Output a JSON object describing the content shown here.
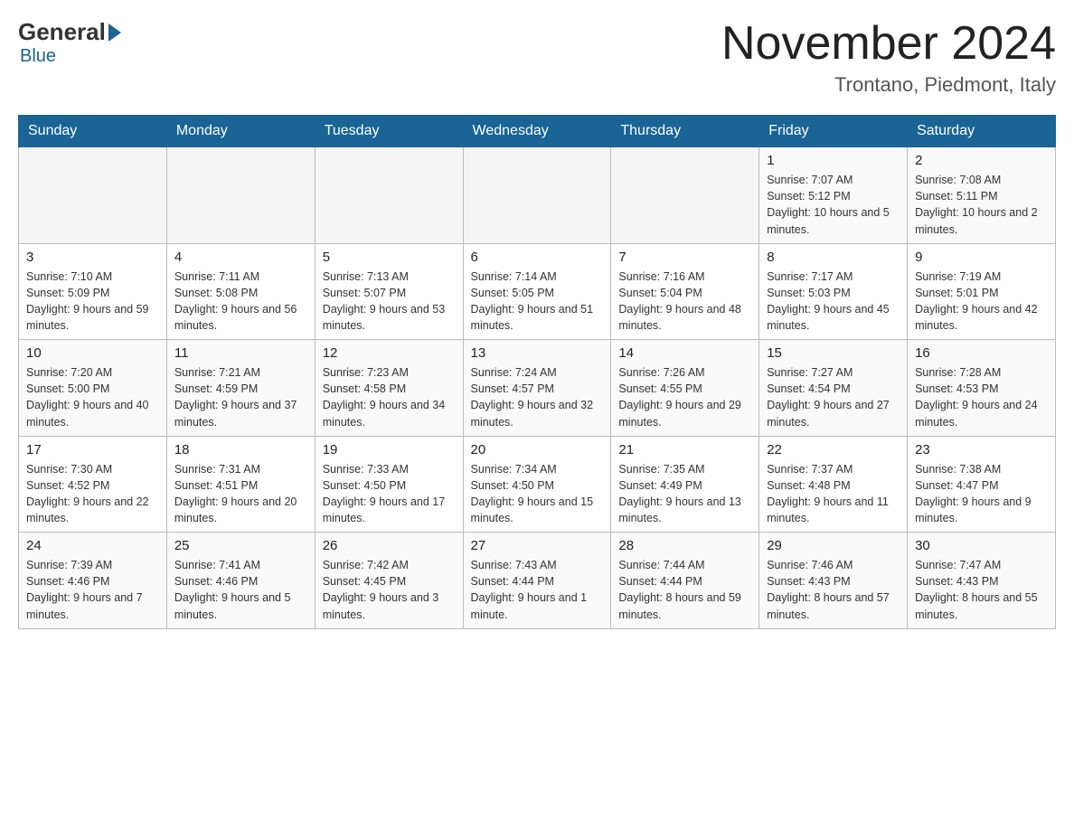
{
  "header": {
    "logo_general": "General",
    "logo_blue": "Blue",
    "month_title": "November 2024",
    "location": "Trontano, Piedmont, Italy"
  },
  "days_of_week": [
    "Sunday",
    "Monday",
    "Tuesday",
    "Wednesday",
    "Thursday",
    "Friday",
    "Saturday"
  ],
  "weeks": [
    {
      "row_style": "odd",
      "days": [
        {
          "date": "",
          "info": ""
        },
        {
          "date": "",
          "info": ""
        },
        {
          "date": "",
          "info": ""
        },
        {
          "date": "",
          "info": ""
        },
        {
          "date": "",
          "info": ""
        },
        {
          "date": "1",
          "info": "Sunrise: 7:07 AM\nSunset: 5:12 PM\nDaylight: 10 hours and 5 minutes."
        },
        {
          "date": "2",
          "info": "Sunrise: 7:08 AM\nSunset: 5:11 PM\nDaylight: 10 hours and 2 minutes."
        }
      ]
    },
    {
      "row_style": "even",
      "days": [
        {
          "date": "3",
          "info": "Sunrise: 7:10 AM\nSunset: 5:09 PM\nDaylight: 9 hours and 59 minutes."
        },
        {
          "date": "4",
          "info": "Sunrise: 7:11 AM\nSunset: 5:08 PM\nDaylight: 9 hours and 56 minutes."
        },
        {
          "date": "5",
          "info": "Sunrise: 7:13 AM\nSunset: 5:07 PM\nDaylight: 9 hours and 53 minutes."
        },
        {
          "date": "6",
          "info": "Sunrise: 7:14 AM\nSunset: 5:05 PM\nDaylight: 9 hours and 51 minutes."
        },
        {
          "date": "7",
          "info": "Sunrise: 7:16 AM\nSunset: 5:04 PM\nDaylight: 9 hours and 48 minutes."
        },
        {
          "date": "8",
          "info": "Sunrise: 7:17 AM\nSunset: 5:03 PM\nDaylight: 9 hours and 45 minutes."
        },
        {
          "date": "9",
          "info": "Sunrise: 7:19 AM\nSunset: 5:01 PM\nDaylight: 9 hours and 42 minutes."
        }
      ]
    },
    {
      "row_style": "odd",
      "days": [
        {
          "date": "10",
          "info": "Sunrise: 7:20 AM\nSunset: 5:00 PM\nDaylight: 9 hours and 40 minutes."
        },
        {
          "date": "11",
          "info": "Sunrise: 7:21 AM\nSunset: 4:59 PM\nDaylight: 9 hours and 37 minutes."
        },
        {
          "date": "12",
          "info": "Sunrise: 7:23 AM\nSunset: 4:58 PM\nDaylight: 9 hours and 34 minutes."
        },
        {
          "date": "13",
          "info": "Sunrise: 7:24 AM\nSunset: 4:57 PM\nDaylight: 9 hours and 32 minutes."
        },
        {
          "date": "14",
          "info": "Sunrise: 7:26 AM\nSunset: 4:55 PM\nDaylight: 9 hours and 29 minutes."
        },
        {
          "date": "15",
          "info": "Sunrise: 7:27 AM\nSunset: 4:54 PM\nDaylight: 9 hours and 27 minutes."
        },
        {
          "date": "16",
          "info": "Sunrise: 7:28 AM\nSunset: 4:53 PM\nDaylight: 9 hours and 24 minutes."
        }
      ]
    },
    {
      "row_style": "even",
      "days": [
        {
          "date": "17",
          "info": "Sunrise: 7:30 AM\nSunset: 4:52 PM\nDaylight: 9 hours and 22 minutes."
        },
        {
          "date": "18",
          "info": "Sunrise: 7:31 AM\nSunset: 4:51 PM\nDaylight: 9 hours and 20 minutes."
        },
        {
          "date": "19",
          "info": "Sunrise: 7:33 AM\nSunset: 4:50 PM\nDaylight: 9 hours and 17 minutes."
        },
        {
          "date": "20",
          "info": "Sunrise: 7:34 AM\nSunset: 4:50 PM\nDaylight: 9 hours and 15 minutes."
        },
        {
          "date": "21",
          "info": "Sunrise: 7:35 AM\nSunset: 4:49 PM\nDaylight: 9 hours and 13 minutes."
        },
        {
          "date": "22",
          "info": "Sunrise: 7:37 AM\nSunset: 4:48 PM\nDaylight: 9 hours and 11 minutes."
        },
        {
          "date": "23",
          "info": "Sunrise: 7:38 AM\nSunset: 4:47 PM\nDaylight: 9 hours and 9 minutes."
        }
      ]
    },
    {
      "row_style": "odd",
      "days": [
        {
          "date": "24",
          "info": "Sunrise: 7:39 AM\nSunset: 4:46 PM\nDaylight: 9 hours and 7 minutes."
        },
        {
          "date": "25",
          "info": "Sunrise: 7:41 AM\nSunset: 4:46 PM\nDaylight: 9 hours and 5 minutes."
        },
        {
          "date": "26",
          "info": "Sunrise: 7:42 AM\nSunset: 4:45 PM\nDaylight: 9 hours and 3 minutes."
        },
        {
          "date": "27",
          "info": "Sunrise: 7:43 AM\nSunset: 4:44 PM\nDaylight: 9 hours and 1 minute."
        },
        {
          "date": "28",
          "info": "Sunrise: 7:44 AM\nSunset: 4:44 PM\nDaylight: 8 hours and 59 minutes."
        },
        {
          "date": "29",
          "info": "Sunrise: 7:46 AM\nSunset: 4:43 PM\nDaylight: 8 hours and 57 minutes."
        },
        {
          "date": "30",
          "info": "Sunrise: 7:47 AM\nSunset: 4:43 PM\nDaylight: 8 hours and 55 minutes."
        }
      ]
    }
  ]
}
